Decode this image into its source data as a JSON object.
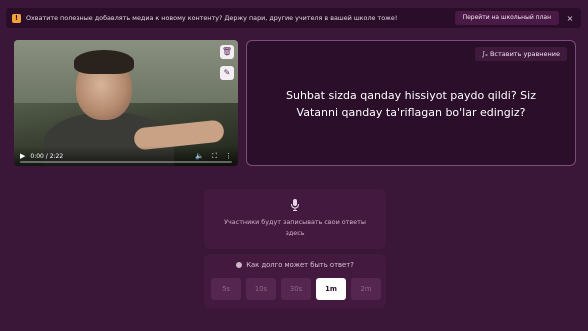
{
  "banner": {
    "icon": "warning-icon",
    "text": "Охватите полезные добавлять медиа к новому контенту? Держу пари, другие учителя в вашей школе тоже!",
    "button_label": "Перейти на школьный план",
    "close_label": "×"
  },
  "video": {
    "time": "0:00 / 2:22",
    "progress": 0,
    "controls": [
      "play-icon",
      "volume-icon",
      "fullscreen-icon",
      "more-icon"
    ]
  },
  "side_buttons": {
    "trash_icon": "trash-icon",
    "pencil_icon": "pencil-icon"
  },
  "question": {
    "insert_equation_label": "∫ₓ Вставить уравнение",
    "text": "Suhbat sizda qanday hissiyot paydo qildi? Siz Vatanni qanday ta'riflagan bo'lar edingiz?"
  },
  "recording": {
    "icon": "microphone-icon",
    "text": "Участники будут записывать свои ответы здесь"
  },
  "duration": {
    "label": "Как долго может быть ответ?",
    "options": [
      "5s",
      "10s",
      "30s",
      "1m",
      "2m"
    ],
    "selected": "1m"
  },
  "colors": {
    "background": "#3a1638",
    "banner": "#2a0d29",
    "accent": "#f3a33a",
    "card": "#2b0f2a",
    "card_border": "#7b4d78"
  }
}
